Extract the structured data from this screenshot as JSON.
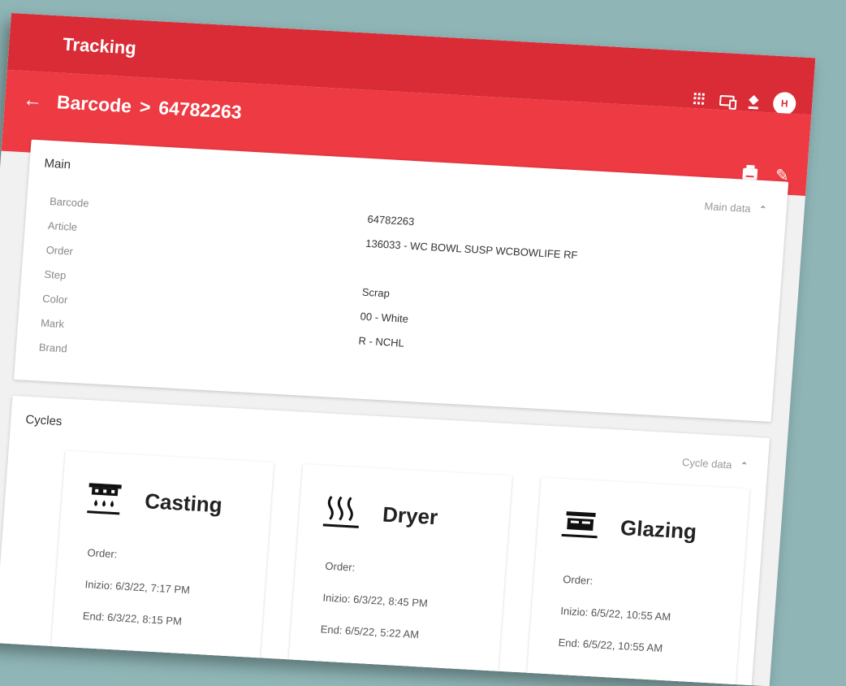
{
  "app": {
    "title": "Tracking",
    "avatar_initial": "H"
  },
  "breadcrumb": {
    "section": "Barcode",
    "separator": ">",
    "current": "64782263"
  },
  "main_card": {
    "title": "Main",
    "toggle_label": "Main data",
    "labels": [
      "Barcode",
      "Article",
      "Order",
      "Step",
      "Color",
      "Mark",
      "Brand"
    ],
    "values": [
      "64782263",
      "136033 - WC BOWL SUSP WCBOWLIFE RF",
      "",
      "Scrap",
      "00 - White",
      "R - NCHL",
      ""
    ]
  },
  "cycles_card": {
    "title": "Cycles",
    "toggle_label": "Cycle data",
    "cycles": [
      {
        "name": "Casting",
        "icon": "casting-icon",
        "order": "Order:",
        "inizio": "Inizio: 6/3/22, 7:17 PM",
        "end": "End: 6/3/22, 8:15 PM"
      },
      {
        "name": "Dryer",
        "icon": "heat-icon",
        "order": "Order:",
        "inizio": "Inizio: 6/3/22, 8:45 PM",
        "end": "End: 6/5/22, 5:22 AM"
      },
      {
        "name": "Glazing",
        "icon": "glazing-icon",
        "order": "Order:",
        "inizio": "Inizio: 6/5/22, 10:55 AM",
        "end": "End: 6/5/22, 10:55 AM"
      }
    ]
  },
  "colors": {
    "topbar": "#d92c36",
    "subbar": "#ee3a42",
    "background": "#8fb5b6"
  }
}
